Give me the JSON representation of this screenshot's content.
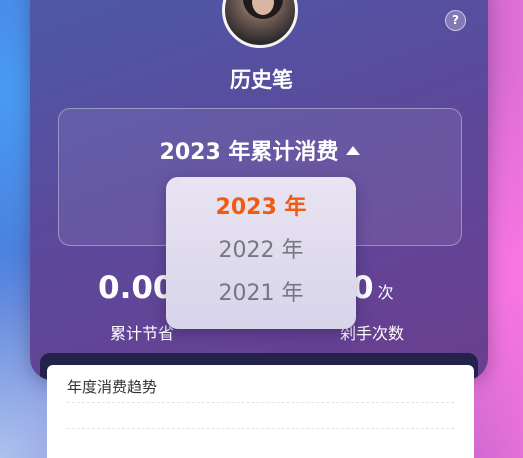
{
  "profile": {
    "username": "历史笔"
  },
  "header": {
    "help_icon_glyph": "?"
  },
  "summary": {
    "year_title": "2023 年累计消费"
  },
  "stats": {
    "saved_value": "0.00",
    "saved_label": "累计节省",
    "orders_value": "0",
    "orders_unit": "次",
    "orders_label": "剁手次数"
  },
  "year_dropdown": {
    "selected": "2023 年",
    "options": [
      "2023 年",
      "2022 年",
      "2021 年"
    ]
  },
  "trend": {
    "title": "年度消费趋势"
  },
  "colors": {
    "selected_year": "#f05a12",
    "unselected_year": "#777781"
  }
}
